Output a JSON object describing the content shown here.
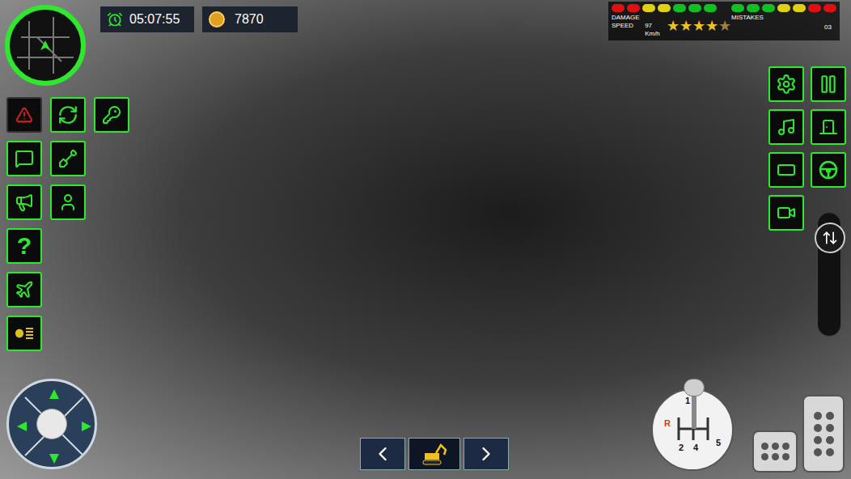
{
  "hud": {
    "timer": "05:07:55",
    "coins": "7870"
  },
  "status": {
    "damage_label": "DAMAGE",
    "speed_label": "SPEED",
    "speed": "97 Km/h",
    "stars": 4,
    "max_stars": 5,
    "left_lights": [
      {
        "color": "#e01010"
      },
      {
        "color": "#e01010"
      },
      {
        "color": "#e0d010"
      },
      {
        "color": "#e0d010"
      },
      {
        "color": "#10c020"
      },
      {
        "color": "#10c020"
      },
      {
        "color": "#10c020"
      }
    ],
    "right_lights": [
      {
        "color": "#10c020"
      },
      {
        "color": "#10c020"
      },
      {
        "color": "#10c020"
      },
      {
        "color": "#e0d010"
      },
      {
        "color": "#e0d010"
      },
      {
        "color": "#e01010"
      },
      {
        "color": "#e01010"
      }
    ],
    "mistakes_label": "MISTAKES",
    "mistakes": "03"
  },
  "help": "?",
  "slider": {
    "level": 0.9
  },
  "shifter": {
    "gears": [
      "1",
      "R",
      "2",
      "4",
      "5"
    ]
  }
}
